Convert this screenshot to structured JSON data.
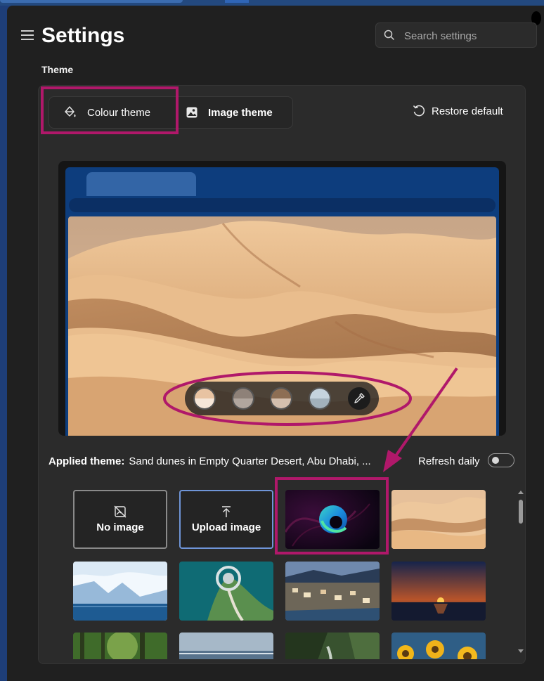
{
  "app": {
    "title": "Settings"
  },
  "search": {
    "placeholder": "Search settings"
  },
  "section": {
    "label": "Theme"
  },
  "tabs": {
    "colour_label": "Colour theme",
    "image_label": "Image theme"
  },
  "restore_label": "Restore default",
  "applied": {
    "prefix": "Applied theme:",
    "value": "Sand dunes in Empty Quarter Desert, Abu Dhabi, ..."
  },
  "refresh": {
    "label": "Refresh daily",
    "on": false
  },
  "gallery": {
    "no_image_label": "No image",
    "upload_label": "Upload image"
  },
  "swatches": [
    {
      "top": "#e8c3a2",
      "bottom": "#f6e6d8"
    },
    {
      "top": "#8e8178",
      "bottom": "#b1a69e"
    },
    {
      "top": "#8d6e54",
      "bottom": "#d4bfae"
    },
    {
      "top": "#c5d3de",
      "bottom": "#a2b1bc"
    }
  ],
  "colors": {
    "annotation": "#b0186a",
    "accent": "#6f95d8"
  }
}
